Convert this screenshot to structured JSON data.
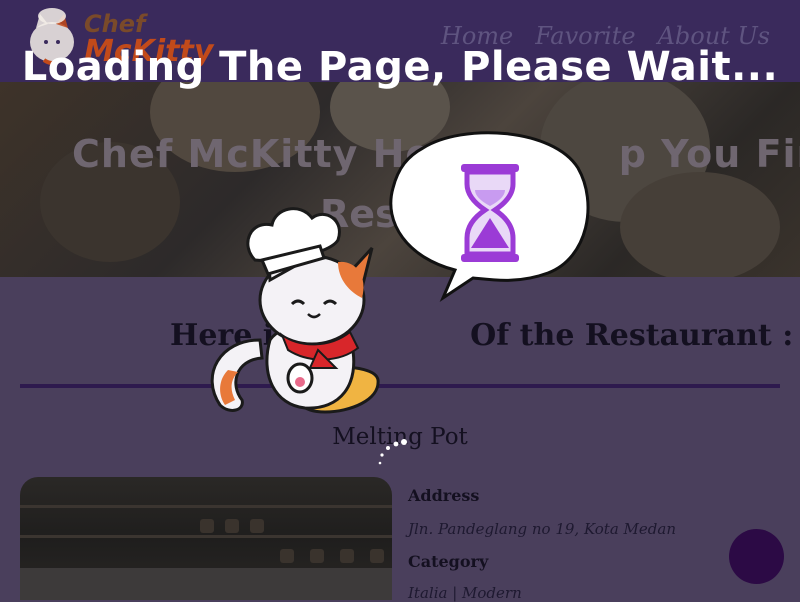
{
  "navbar": {
    "logo": {
      "line1": "Chef",
      "line2": "McKitty"
    },
    "links": [
      "Home",
      "Favorite",
      "About Us"
    ]
  },
  "hero": {
    "title": "Chef McKitty Here",
    "title_partial_2": "p You Find",
    "subtitle_partial": "Resta"
  },
  "section": {
    "heading_left": "Here i",
    "heading_right": "Of the Restaurant :"
  },
  "restaurant": {
    "name": "Melting Pot",
    "address_label": "Address",
    "address": "Jln. Pandeglang no 19, Kota Medan",
    "category_label": "Category",
    "category": "Italia | Modern"
  },
  "overlay": {
    "message": "Loading The Page, Please Wait..."
  },
  "colors": {
    "navbar": "#3a2a5c",
    "page_bg": "#4a3f5c",
    "accent": "#2c0a45",
    "hourglass": "#9b3bd6"
  },
  "icons": {
    "bubble": "hourglass-icon",
    "mascot": "chef-cat-icon",
    "spinner": "loading-spinner-icon",
    "fab": "chat-icon"
  }
}
